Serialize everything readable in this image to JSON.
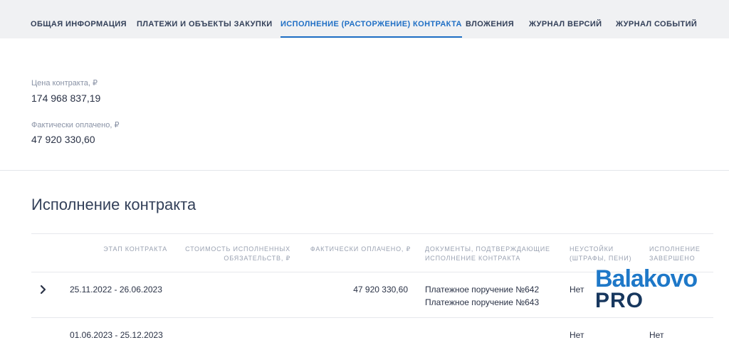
{
  "tabs": [
    {
      "label": "ОБЩАЯ ИНФОРМАЦИЯ",
      "active": false
    },
    {
      "label": "ПЛАТЕЖИ И ОБЪЕКТЫ ЗАКУПКИ",
      "active": false
    },
    {
      "label": "ИСПОЛНЕНИЕ (РАСТОРЖЕНИЕ) КОНТРАКТА",
      "active": true
    },
    {
      "label": "ВЛОЖЕНИЯ",
      "active": false
    },
    {
      "label": "ЖУРНАЛ ВЕРСИЙ",
      "active": false
    },
    {
      "label": "ЖУРНАЛ СОБЫТИЙ",
      "active": false
    }
  ],
  "summary": {
    "price_label": "Цена контракта, ₽",
    "price_value": "174 968 837,19",
    "paid_label": "Фактически оплачено, ₽",
    "paid_value": "47 920 330,60"
  },
  "section": {
    "title": "Исполнение контракта"
  },
  "table": {
    "headers": {
      "stage": "ЭТАП КОНТРАКТА",
      "cost_line1": "СТОИМОСТЬ ИСПОЛНЕННЫХ",
      "cost_line2": "ОБЯЗАТЕЛЬСТВ, ₽",
      "paid": "ФАКТИЧЕСКИ ОПЛАЧЕНО, ₽",
      "docs_line1": "ДОКУМЕНТЫ, ПОДТВЕРЖДАЮЩИЕ",
      "docs_line2": "ИСПОЛНЕНИЕ КОНТРАКТА",
      "penalty_line1": "НЕУСТОЙКИ",
      "penalty_line2": "(ШТРАФЫ, ПЕНИ)",
      "done_line1": "ИСПОЛНЕНИЕ",
      "done_line2": "ЗАВЕРШЕНО"
    },
    "rows": [
      {
        "stage": "25.11.2022 - 26.06.2023",
        "paid": "47 920 330,60",
        "doc1": "Платежное поручение №642",
        "doc2": "Платежное поручение №643",
        "penalty": "Нет"
      },
      {
        "stage": "01.06.2023 - 25.12.2023",
        "penalty": "Нет",
        "done": "Нет"
      }
    ]
  },
  "watermark": {
    "top": "Balakovo",
    "bottom": "PRO"
  },
  "icons": {
    "expand": "chevron-right-icon"
  },
  "colors": {
    "accent": "#1f6fc5",
    "tab_bar_bg": "#f0f1f3",
    "text": "#334059",
    "muted": "#8a93a6",
    "watermark_blue": "#1e78c8",
    "watermark_navy": "#17375e"
  }
}
